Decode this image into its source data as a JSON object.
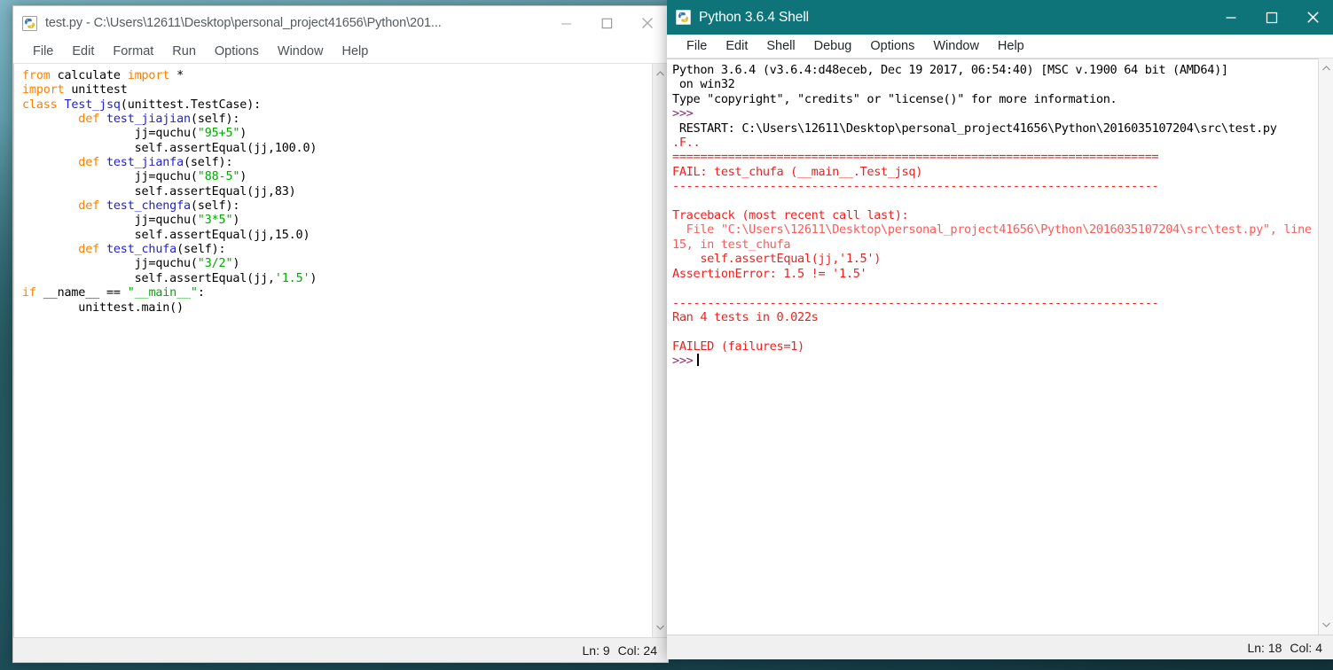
{
  "desktop": {
    "background_colors": [
      "#7fb5c4",
      "#3d7b88",
      "#12333b"
    ]
  },
  "editor_window": {
    "title": "test.py - C:\\Users\\12611\\Desktop\\personal_project41656\\Python\\201...",
    "icon": "python-file-icon",
    "active": false,
    "controls": {
      "minimize": "minimize-icon",
      "maximize": "maximize-icon",
      "close": "close-icon"
    },
    "menu": [
      "File",
      "Edit",
      "Format",
      "Run",
      "Options",
      "Window",
      "Help"
    ],
    "status": {
      "line_label": "Ln: 9",
      "col_label": "Col: 24"
    },
    "code_lines": [
      [
        {
          "t": "from ",
          "c": "kw"
        },
        {
          "t": "calculate ",
          "c": "blk"
        },
        {
          "t": "import ",
          "c": "kw"
        },
        {
          "t": "*",
          "c": "blk"
        }
      ],
      [
        {
          "t": "import ",
          "c": "kw"
        },
        {
          "t": "unittest",
          "c": "blk"
        }
      ],
      [
        {
          "t": "class ",
          "c": "kw"
        },
        {
          "t": "Test_jsq",
          "c": "cls"
        },
        {
          "t": "(unittest.TestCase):",
          "c": "blk"
        }
      ],
      [
        {
          "t": "        ",
          "c": "blk"
        },
        {
          "t": "def ",
          "c": "kw"
        },
        {
          "t": "test_jiajian",
          "c": "fn"
        },
        {
          "t": "(self):",
          "c": "blk"
        }
      ],
      [
        {
          "t": "                jj=quchu(",
          "c": "blk"
        },
        {
          "t": "\"95+5\"",
          "c": "str"
        },
        {
          "t": ")",
          "c": "blk"
        }
      ],
      [
        {
          "t": "                self.assertEqual(jj,100.0)",
          "c": "blk"
        }
      ],
      [
        {
          "t": "        ",
          "c": "blk"
        },
        {
          "t": "def ",
          "c": "kw"
        },
        {
          "t": "test_jianfa",
          "c": "fn"
        },
        {
          "t": "(self):",
          "c": "blk"
        }
      ],
      [
        {
          "t": "                jj=quchu(",
          "c": "blk"
        },
        {
          "t": "\"88-5\"",
          "c": "str"
        },
        {
          "t": ")",
          "c": "blk"
        }
      ],
      [
        {
          "t": "                self.assertEqual(jj,83)",
          "c": "blk"
        }
      ],
      [
        {
          "t": "        ",
          "c": "blk"
        },
        {
          "t": "def ",
          "c": "kw"
        },
        {
          "t": "test_chengfa",
          "c": "fn"
        },
        {
          "t": "(self):",
          "c": "blk"
        }
      ],
      [
        {
          "t": "                jj=quchu(",
          "c": "blk"
        },
        {
          "t": "\"3*5\"",
          "c": "str"
        },
        {
          "t": ")",
          "c": "blk"
        }
      ],
      [
        {
          "t": "                self.assertEqual(jj,15.0)",
          "c": "blk"
        }
      ],
      [
        {
          "t": "        ",
          "c": "blk"
        },
        {
          "t": "def ",
          "c": "kw"
        },
        {
          "t": "test_chufa",
          "c": "fn"
        },
        {
          "t": "(self):",
          "c": "blk"
        }
      ],
      [
        {
          "t": "                jj=quchu(",
          "c": "blk"
        },
        {
          "t": "\"3/2\"",
          "c": "str"
        },
        {
          "t": ")",
          "c": "blk"
        }
      ],
      [
        {
          "t": "                self.assertEqual(jj,",
          "c": "blk"
        },
        {
          "t": "'1.5'",
          "c": "str"
        },
        {
          "t": ")",
          "c": "blk"
        }
      ],
      [
        {
          "t": "if ",
          "c": "kw"
        },
        {
          "t": "__name__ == ",
          "c": "blk"
        },
        {
          "t": "\"__main__\"",
          "c": "str"
        },
        {
          "t": ":",
          "c": "blk"
        }
      ],
      [
        {
          "t": "        unittest.main()",
          "c": "blk"
        }
      ]
    ]
  },
  "shell_window": {
    "title": "Python 3.6.4 Shell",
    "icon": "python-app-icon",
    "active": true,
    "accent_color": "#0f7479",
    "controls": {
      "minimize": "minimize-icon",
      "maximize": "maximize-icon",
      "close": "close-icon"
    },
    "menu": [
      "File",
      "Edit",
      "Shell",
      "Debug",
      "Options",
      "Window",
      "Help"
    ],
    "status": {
      "line_label": "Ln: 18",
      "col_label": "Col: 4"
    },
    "output_lines": [
      [
        {
          "t": "Python 3.6.4 (v3.6.4:d48eceb, Dec 19 2017, 06:54:40) [MSC v.1900 64 bit (AMD64)]",
          "c": "blkline"
        }
      ],
      [
        {
          "t": " on win32",
          "c": "blkline"
        }
      ],
      [
        {
          "t": "Type \"copyright\", \"credits\" or \"license()\" for more information.",
          "c": "blkline"
        }
      ],
      [
        {
          "t": ">>>",
          "c": "prompt"
        }
      ],
      [
        {
          "t": " RESTART: C:\\Users\\12611\\Desktop\\personal_project41656\\Python\\2016035107204\\src\\test.py",
          "c": "blkline"
        }
      ],
      [
        {
          "t": ".F..",
          "c": "err"
        }
      ],
      [
        {
          "t": "======================================================================",
          "c": "err"
        }
      ],
      [
        {
          "t": "FAIL: test_chufa (__main__.Test_jsq)",
          "c": "err"
        }
      ],
      [
        {
          "t": "----------------------------------------------------------------------",
          "c": "err"
        }
      ],
      [
        {
          "t": "",
          "c": "err"
        }
      ],
      [
        {
          "t": "Traceback (most recent call last):",
          "c": "err"
        }
      ],
      [
        {
          "t": "  File \"C:\\Users\\12611\\Desktop\\personal_project41656\\Python\\2016035107204\\src\\test.py\", line 15, in test_chufa",
          "c": "errf"
        }
      ],
      [
        {
          "t": "    self.assertEqual(jj,'1.5')",
          "c": "err"
        }
      ],
      [
        {
          "t": "AssertionError: 1.5 != '1.5'",
          "c": "err"
        }
      ],
      [
        {
          "t": "",
          "c": "err"
        }
      ],
      [
        {
          "t": "----------------------------------------------------------------------",
          "c": "err"
        }
      ],
      [
        {
          "t": "Ran 4 tests in 0.022s",
          "c": "err"
        }
      ],
      [
        {
          "t": "",
          "c": "err"
        }
      ],
      [
        {
          "t": "FAILED (failures=1)",
          "c": "err"
        }
      ]
    ],
    "final_prompt": ">>>"
  }
}
